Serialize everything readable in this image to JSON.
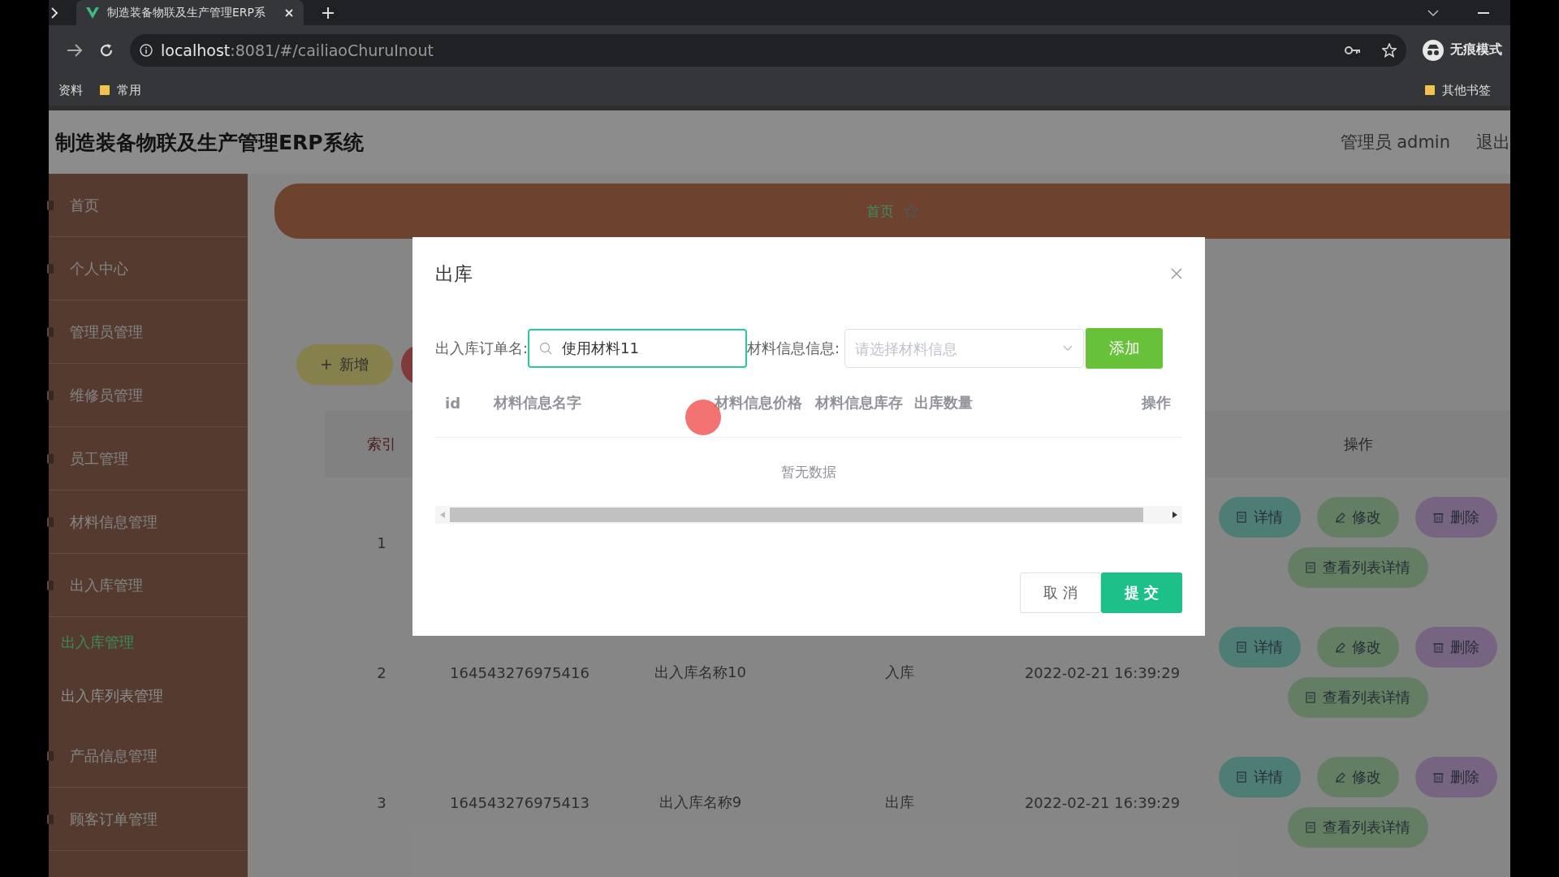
{
  "browser": {
    "tab_title": "制造装备物联及生产管理ERP系",
    "url_host": "localhost",
    "url_rest": ":8081/#/cailiaoChuruInout",
    "incognito_label": "无痕模式",
    "bookmarks": [
      {
        "label": "资料",
        "kind": "plain"
      },
      {
        "label": "常用",
        "kind": "folder"
      }
    ],
    "other_bookmarks": "其他书签"
  },
  "app": {
    "title": "制造装备物联及生产管理ERP系统",
    "user": "管理员 admin",
    "logout": "退出"
  },
  "sidebar": {
    "items": [
      {
        "label": "首页"
      },
      {
        "label": "个人中心"
      },
      {
        "label": "管理员管理"
      },
      {
        "label": "维修员管理"
      },
      {
        "label": "员工管理"
      },
      {
        "label": "材料信息管理"
      },
      {
        "label": "出入库管理",
        "children": [
          {
            "label": "出入库管理",
            "selected": true
          },
          {
            "label": "出入库列表管理",
            "selected": false
          }
        ]
      },
      {
        "label": "产品信息管理"
      },
      {
        "label": "顾客订单管理"
      }
    ]
  },
  "breadcrumb": {
    "items": [
      {
        "label": "首页"
      }
    ]
  },
  "toolbar": {
    "buttons": [
      {
        "label": "新增",
        "kind": "add"
      }
    ]
  },
  "table": {
    "header": {
      "index": "索引",
      "actions": "操作"
    },
    "rows": [
      {
        "index": "1",
        "actions": [
          {
            "label": "详情",
            "kind": "detail"
          },
          {
            "label": "修改",
            "kind": "edit"
          },
          {
            "label": "删除",
            "kind": "delete"
          },
          {
            "label": "查看列表详情",
            "kind": "list"
          }
        ]
      },
      {
        "index": "2",
        "id": "164543276975416",
        "name": "出入库名称10",
        "type": "入库",
        "time": "2022-02-21 16:39:29",
        "actions": [
          {
            "label": "详情",
            "kind": "detail"
          },
          {
            "label": "修改",
            "kind": "edit"
          },
          {
            "label": "删除",
            "kind": "delete"
          },
          {
            "label": "查看列表详情",
            "kind": "list"
          }
        ]
      },
      {
        "index": "3",
        "id": "164543276975413",
        "name": "出入库名称9",
        "type": "出库",
        "time": "2022-02-21 16:39:29",
        "actions": [
          {
            "label": "详情",
            "kind": "detail"
          },
          {
            "label": "修改",
            "kind": "edit"
          },
          {
            "label": "删除",
            "kind": "delete"
          },
          {
            "label": "查看列表详情",
            "kind": "list"
          }
        ]
      }
    ]
  },
  "dialog": {
    "title": "出库",
    "fields": [
      {
        "label": "出入库订单名:",
        "kind": "search",
        "value": "使用材料11"
      },
      {
        "label": "材料信息信息:",
        "kind": "select",
        "placeholder": "请选择材料信息"
      }
    ],
    "add_button": "添加",
    "table": {
      "columns": [
        "id",
        "材料信息名字",
        "材料信息价格",
        "材料信息库存",
        "出库数量",
        "操作"
      ],
      "empty_text": "暂无数据"
    },
    "buttons": [
      {
        "label": "取 消",
        "kind": "cancel"
      },
      {
        "label": "提 交",
        "kind": "submit"
      }
    ]
  }
}
